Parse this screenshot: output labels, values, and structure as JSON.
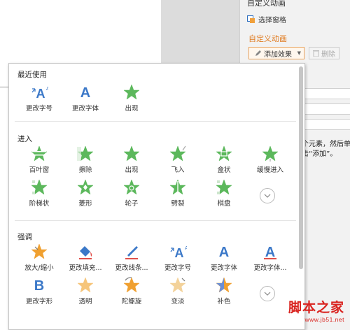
{
  "task_pane": {
    "title": "自定义动画",
    "select_pane": "选择窗格",
    "custom_animation": "自定义动画",
    "add_effect": "添加效果",
    "delete": "删除",
    "hint": "个元素，然后单击“添加”。"
  },
  "effects_panel": {
    "recent": {
      "title": "最近使用",
      "items": [
        {
          "label": "更改字号",
          "icon": "font-size-a-icon"
        },
        {
          "label": "更改字体",
          "icon": "font-a-icon"
        },
        {
          "label": "出现",
          "icon": "star-appear-icon"
        }
      ]
    },
    "entrance": {
      "title": "进入",
      "items": [
        {
          "label": "百叶窗",
          "icon": "blinds-star-icon"
        },
        {
          "label": "擦除",
          "icon": "wipe-star-icon"
        },
        {
          "label": "出现",
          "icon": "appear-star-icon"
        },
        {
          "label": "飞入",
          "icon": "fly-in-star-icon"
        },
        {
          "label": "盒状",
          "icon": "box-star-icon"
        },
        {
          "label": "缓慢进入",
          "icon": "crawl-in-star-icon"
        },
        {
          "label": "阶梯状",
          "icon": "checkerboard-star-icon"
        },
        {
          "label": "菱形",
          "icon": "diamond-star-icon"
        },
        {
          "label": "轮子",
          "icon": "wheel-star-icon"
        },
        {
          "label": "劈裂",
          "icon": "split-star-icon"
        },
        {
          "label": "棋盘",
          "icon": "checkerboard-star-icon"
        }
      ]
    },
    "emphasis": {
      "title": "强调",
      "items": [
        {
          "label": "放大/缩小",
          "icon": "grow-shrink-star-icon"
        },
        {
          "label": "更改填充...",
          "icon": "fill-bucket-icon"
        },
        {
          "label": "更改线条...",
          "icon": "line-pen-icon"
        },
        {
          "label": "更改字号",
          "icon": "font-size-a-icon"
        },
        {
          "label": "更改字体",
          "icon": "font-a-icon"
        },
        {
          "label": "更改字体...",
          "icon": "font-color-a-icon"
        },
        {
          "label": "更改字形",
          "icon": "bold-b-icon"
        },
        {
          "label": "透明",
          "icon": "transparent-star-icon"
        },
        {
          "label": "陀螺旋",
          "icon": "spin-star-icon"
        },
        {
          "label": "变淡",
          "icon": "desaturate-star-icon"
        },
        {
          "label": "补色",
          "icon": "complementary-star-icon"
        }
      ]
    }
  },
  "watermark": {
    "main": "脚本之家",
    "sub": "www.jb51.net"
  },
  "colors": {
    "entrance_star": "#5cb85c",
    "emphasis_star": "#f0a030",
    "text_blue": "#3b78c8",
    "accent_orange": "#e07a1e",
    "watermark_red": "#d9231f"
  }
}
